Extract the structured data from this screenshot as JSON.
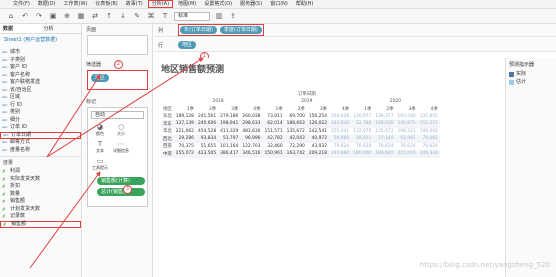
{
  "menu": [
    "文件(F)",
    "数据(D)",
    "工作表(W)",
    "仪表板(B)",
    "故事(T)",
    "分析(A)",
    "地图(M)",
    "设置格式(O)",
    "服务器(S)",
    "窗口(N)",
    "帮助(H)"
  ],
  "toolbar": {
    "fit_select": "标准"
  },
  "left_panel": {
    "tab_data": "数据",
    "tab_analytics": "分析",
    "datasource": "Sheet1 (用户运营数据)",
    "dimensions": [
      "城市",
      "子类别",
      "客户 ID",
      "客户名称",
      "客户联络发送",
      "省/自治区",
      "区域",
      "行 ID",
      "类别",
      "细分",
      "订单 ID",
      "订单日期",
      "邮寄方式",
      "度量名称"
    ],
    "measures_header": "度量",
    "measures": [
      "利润",
      "实际发货天数",
      "折扣",
      "数量",
      "销售额",
      "计划发货天数",
      "记录数",
      "销售额"
    ]
  },
  "shelves": {
    "pages_label": "页面",
    "filters_label": "筛选器",
    "filter_pill": "地区",
    "marks_label": "标记",
    "marks_type": "自动",
    "mark_buttons": [
      "颜色",
      "大小",
      "文本",
      "详细信息",
      "工具提示"
    ],
    "mark_pill_1": "销售额(计算)",
    "mark_pill_2": "总计(销售额)"
  },
  "columns": {
    "label": "列",
    "pill1": "年(订单日期)",
    "pill2": "季度(订单日期)"
  },
  "rows": {
    "label": "行",
    "pill": "地区"
  },
  "annotations": [
    "1",
    "2",
    "3"
  ],
  "view": {
    "title": "地区销售额预测",
    "col_header": "订单日期",
    "years": [
      "2018",
      "2019",
      "2020"
    ],
    "region_header": "地区",
    "quarters": [
      "1季",
      "2季",
      "3季",
      "4季",
      "1季",
      "2季",
      "3季",
      "4季",
      "1季",
      "2季",
      "3季",
      "4季"
    ],
    "rows": [
      {
        "region": "东北",
        "values": [
          "189,128",
          "241,561",
          "279,186",
          "260,038",
          "73,911",
          "69,700",
          "156,254",
          "260,038",
          "120,977",
          "139,377",
          "193,566",
          "135,855"
        ]
      },
      {
        "region": "华东",
        "values": [
          "137,139",
          "240,606",
          "198,941",
          "298,633",
          "82,014",
          "188,663",
          "126,022",
          "241,030",
          "52,788",
          "168,030",
          "140,872",
          "155,271"
        ]
      },
      {
        "region": "华北",
        "values": [
          "221,062",
          "454,528",
          "411,329",
          "483,630",
          "151,571",
          "135,672",
          "242,541",
          "255,041",
          "122,075",
          "135,672",
          "196,321",
          "199,042"
        ]
      },
      {
        "region": "西北",
        "values": [
          "29,286",
          "93,834",
          "51,797",
          "96,996",
          "42,782",
          "42,043",
          "40,972",
          "56,980",
          "58,021",
          "57,140",
          "61,981",
          "79,061"
        ]
      },
      {
        "region": "西南",
        "values": [
          "70,375",
          "51,655",
          "101,164",
          "122,703",
          "32,460",
          "72,290",
          "43,932",
          "79,624",
          "76,624",
          "70,624",
          "76,624",
          "79,624"
        ]
      },
      {
        "region": "中南",
        "values": [
          "255,072",
          "423,505",
          "386,417",
          "346,516",
          "150,961",
          "163,742",
          "209,218",
          "297,660",
          "180,000",
          "186,640",
          "215,000",
          "249,330"
        ]
      }
    ]
  },
  "legend": {
    "title": "预测指示器",
    "items": [
      {
        "label": "实际",
        "color": "#4e79a7"
      },
      {
        "label": "估计",
        "color": "#a0cbe8"
      }
    ]
  },
  "watermark": "https://blog.csdn.net/yangzheng_520"
}
